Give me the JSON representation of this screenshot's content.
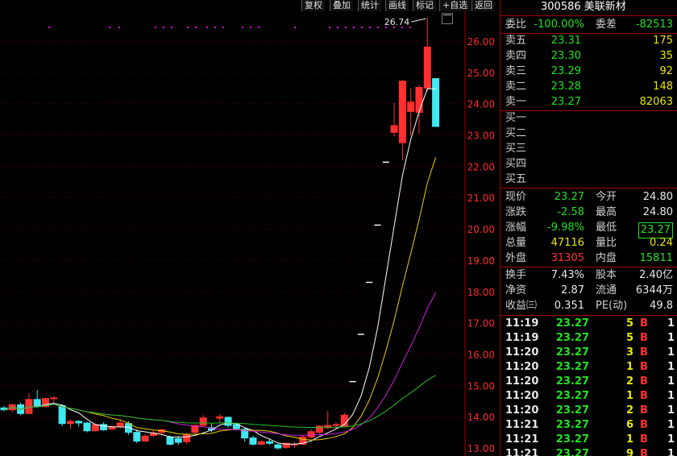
{
  "toolbar": {
    "buttons": [
      "复权",
      "叠加",
      "统计",
      "画线",
      "标记",
      "+自选",
      "返回"
    ],
    "marker": "◇"
  },
  "chart_data": {
    "type": "candlestick",
    "y_ticks": [
      "26.00",
      "25.00",
      "24.00",
      "23.00",
      "22.00",
      "21.00",
      "20.00",
      "19.00",
      "18.00",
      "17.00",
      "16.00",
      "15.00",
      "14.00",
      "13.00"
    ],
    "ylim": [
      12.95,
      26.95
    ],
    "high_label": "26.74",
    "candles": [
      [
        14.28,
        14.34,
        14.18,
        14.22
      ],
      [
        14.22,
        14.42,
        14.15,
        14.38
      ],
      [
        14.38,
        14.45,
        14.05,
        14.1
      ],
      [
        14.1,
        14.75,
        14.08,
        14.55
      ],
      [
        14.55,
        14.85,
        14.28,
        14.32
      ],
      [
        14.32,
        14.6,
        14.3,
        14.58
      ],
      [
        14.58,
        14.66,
        14.45,
        14.6
      ],
      [
        14.35,
        14.4,
        13.7,
        13.78
      ],
      [
        13.78,
        13.92,
        13.6,
        13.85
      ],
      [
        13.85,
        13.9,
        13.68,
        13.8
      ],
      [
        13.8,
        13.83,
        13.5,
        13.55
      ],
      [
        13.55,
        13.78,
        13.52,
        13.75
      ],
      [
        13.75,
        13.82,
        13.55,
        13.58
      ],
      [
        13.6,
        13.72,
        13.58,
        13.68
      ],
      [
        13.7,
        13.88,
        13.62,
        13.8
      ],
      [
        13.78,
        13.85,
        13.42,
        13.5
      ],
      [
        13.5,
        13.6,
        13.15,
        13.22
      ],
      [
        13.22,
        13.45,
        13.2,
        13.38
      ],
      [
        13.4,
        13.55,
        13.35,
        13.48
      ],
      [
        13.5,
        13.62,
        13.4,
        13.58
      ],
      [
        13.35,
        13.4,
        13.08,
        13.12
      ],
      [
        13.3,
        13.38,
        13.1,
        13.18
      ],
      [
        13.2,
        13.48,
        13.12,
        13.42
      ],
      [
        13.5,
        13.75,
        13.44,
        13.72
      ],
      [
        13.72,
        14.05,
        13.7,
        13.96
      ],
      [
        13.65,
        13.8,
        13.5,
        13.58
      ],
      [
        13.95,
        14.08,
        13.78,
        14.0
      ],
      [
        13.98,
        14.0,
        13.65,
        13.72
      ],
      [
        13.75,
        13.8,
        13.58,
        13.62
      ],
      [
        13.6,
        13.65,
        13.2,
        13.32
      ],
      [
        13.32,
        13.4,
        13.08,
        13.12
      ],
      [
        13.12,
        13.25,
        13.08,
        13.2
      ],
      [
        13.2,
        13.28,
        13.1,
        13.15
      ],
      [
        13.1,
        13.15,
        12.95,
        13.0
      ],
      [
        13.02,
        13.18,
        12.98,
        13.15
      ],
      [
        13.1,
        13.2,
        13.0,
        13.12
      ],
      [
        13.12,
        13.42,
        13.1,
        13.35
      ],
      [
        13.35,
        13.6,
        13.3,
        13.52
      ],
      [
        13.5,
        13.72,
        13.45,
        13.7
      ],
      [
        13.65,
        14.18,
        13.6,
        13.72
      ],
      [
        13.72,
        13.82,
        13.6,
        13.75
      ],
      [
        13.7,
        14.12,
        13.66,
        14.05
      ],
      [
        15.12,
        15.12,
        15.12,
        15.12
      ],
      [
        16.63,
        16.63,
        16.63,
        16.63
      ],
      [
        18.29,
        18.29,
        18.29,
        18.29
      ],
      [
        20.12,
        20.12,
        20.12,
        20.12
      ],
      [
        22.13,
        22.13,
        22.13,
        22.13
      ],
      [
        23.08,
        24.03,
        22.95,
        23.3
      ],
      [
        22.75,
        24.75,
        22.2,
        24.72
      ],
      [
        23.75,
        24.48,
        23.0,
        24.05
      ],
      [
        23.72,
        24.58,
        23.05,
        24.52
      ],
      [
        24.5,
        26.74,
        24.4,
        25.81
      ],
      [
        24.8,
        24.8,
        23.27,
        23.27
      ]
    ],
    "ma": [
      {
        "name": "MA5",
        "color": "#ffffff"
      },
      {
        "name": "MA10",
        "color": "#e8d000"
      },
      {
        "name": "MA20",
        "color": "#d020e0"
      },
      {
        "name": "MA60",
        "color": "#20c020"
      }
    ]
  },
  "quote": {
    "title": "300586 美联新材",
    "weibi": {
      "label": "委比",
      "value": "-100.00%",
      "label2": "委差",
      "value2": "-82513"
    },
    "asks": [
      {
        "label": "卖五",
        "price": "23.31",
        "vol": "175"
      },
      {
        "label": "卖四",
        "price": "23.30",
        "vol": "35"
      },
      {
        "label": "卖三",
        "price": "23.29",
        "vol": "92"
      },
      {
        "label": "卖二",
        "price": "23.28",
        "vol": "148"
      },
      {
        "label": "卖一",
        "price": "23.27",
        "vol": "82063"
      }
    ],
    "bids": [
      "买一",
      "买二",
      "买三",
      "买四",
      "买五"
    ],
    "stats": [
      {
        "l1": "现价",
        "v1": "23.27",
        "c1": "green",
        "l2": "今开",
        "v2": "24.80",
        "c2": "white"
      },
      {
        "l1": "涨跌",
        "v1": "-2.58",
        "c1": "green",
        "l2": "最高",
        "v2": "24.80",
        "c2": "white"
      },
      {
        "l1": "涨幅",
        "v1": "-9.98%",
        "c1": "green",
        "l2": "最低",
        "v2": "23.27",
        "c2": "green"
      },
      {
        "l1": "总量",
        "v1": "47116",
        "c1": "yellow",
        "l2": "量比",
        "v2": "0.24",
        "c2": "yellow"
      },
      {
        "l1": "外盘",
        "v1": "31305",
        "c1": "red",
        "l2": "内盘",
        "v2": "15811",
        "c2": "green"
      }
    ],
    "fundamentals": [
      {
        "l1": "换手",
        "v1": "7.43%",
        "l2": "股本",
        "v2": "2.40亿"
      },
      {
        "l1": "净资",
        "v1": "2.87",
        "l2": "流通",
        "v2": "6344万"
      },
      {
        "l1": "收益㈢",
        "v1": "0.351",
        "l2": "PE(动)",
        "v2": "49.8"
      }
    ],
    "ticks": [
      {
        "time": "11:19",
        "price": "23.27",
        "vol": "5",
        "bs": "B",
        "cnt": "1"
      },
      {
        "time": "11:19",
        "price": "23.27",
        "vol": "5",
        "bs": "B",
        "cnt": "1"
      },
      {
        "time": "11:20",
        "price": "23.27",
        "vol": "3",
        "bs": "B",
        "cnt": "1"
      },
      {
        "time": "11:20",
        "price": "23.27",
        "vol": "1",
        "bs": "B",
        "cnt": "1"
      },
      {
        "time": "11:20",
        "price": "23.27",
        "vol": "2",
        "bs": "B",
        "cnt": "1"
      },
      {
        "time": "11:20",
        "price": "23.27",
        "vol": "1",
        "bs": "B",
        "cnt": "1"
      },
      {
        "time": "11:20",
        "price": "23.27",
        "vol": "2",
        "bs": "B",
        "cnt": "1"
      },
      {
        "time": "11:21",
        "price": "23.27",
        "vol": "6",
        "bs": "B",
        "cnt": "1"
      },
      {
        "time": "11:21",
        "price": "23.27",
        "vol": "1",
        "bs": "B",
        "cnt": "1"
      },
      {
        "time": "11:21",
        "price": "23.27",
        "vol": "9",
        "bs": "B",
        "cnt": "1"
      }
    ]
  }
}
